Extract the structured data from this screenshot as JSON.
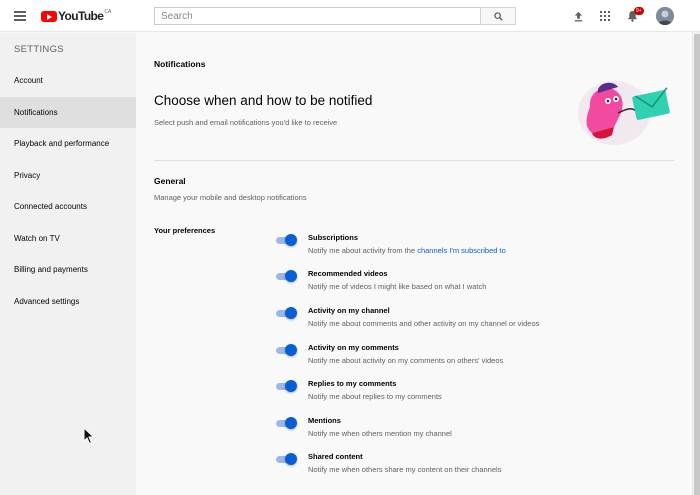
{
  "header": {
    "logo_text": "YouTube",
    "country_code": "CA",
    "search_placeholder": "Search",
    "notification_count": "9+"
  },
  "sidebar": {
    "heading": "SETTINGS",
    "items": [
      {
        "label": "Account"
      },
      {
        "label": "Notifications",
        "active": true
      },
      {
        "label": "Playback and performance"
      },
      {
        "label": "Privacy"
      },
      {
        "label": "Connected accounts"
      },
      {
        "label": "Watch on TV"
      },
      {
        "label": "Billing and payments"
      },
      {
        "label": "Advanced settings"
      }
    ]
  },
  "main": {
    "page_title": "Notifications",
    "headline": "Choose when and how to be notified",
    "subheadline": "Select push and email notifications you'd like to receive",
    "section": {
      "title": "General",
      "subtitle": "Manage your mobile and desktop notifications",
      "preferences_label": "Your preferences",
      "preferences": [
        {
          "title": "Subscriptions",
          "desc": "Notify me about activity from the ",
          "link": "channels I'm subscribed to",
          "enabled": true
        },
        {
          "title": "Recommended videos",
          "desc": "Notify me of videos I might like based on what I watch",
          "enabled": true
        },
        {
          "title": "Activity on my channel",
          "desc": "Notify me about comments and other activity on my channel or videos",
          "enabled": true
        },
        {
          "title": "Activity on my comments",
          "desc": "Notify me about activity on my comments on others' videos",
          "enabled": true
        },
        {
          "title": "Replies to my comments",
          "desc": "Notify me about replies to my comments",
          "enabled": true
        },
        {
          "title": "Mentions",
          "desc": "Notify me when others mention my channel",
          "enabled": true
        },
        {
          "title": "Shared content",
          "desc": "Notify me when others share my content on their channels",
          "enabled": true
        }
      ]
    }
  },
  "colors": {
    "brand_red": "#ff0000",
    "toggle_on": "#065fd4",
    "link": "#065fd4"
  },
  "icons": [
    "menu-icon",
    "search-icon",
    "upload-icon",
    "apps-icon",
    "bell-icon"
  ]
}
